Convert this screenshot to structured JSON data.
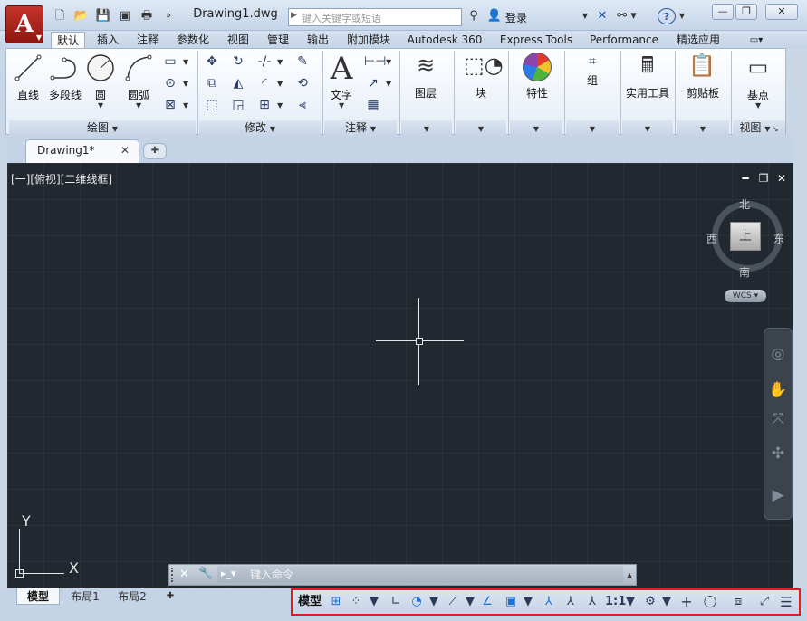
{
  "title": {
    "doc_name": "Drawing1.dwg",
    "search_placeholder": "键入关键字或短语",
    "login_label": "登录",
    "help_label": "?",
    "minimize": "—",
    "restore": "❐",
    "close": "✕"
  },
  "ribbon_tabs": [
    "默认",
    "插入",
    "注释",
    "参数化",
    "视图",
    "管理",
    "输出",
    "附加模块",
    "Autodesk 360",
    "Express Tools",
    "Performance",
    "精选应用"
  ],
  "ribbon": {
    "draw_tools": [
      "直线",
      "多段线",
      "圆",
      "圆弧"
    ],
    "text_label": "文字",
    "layer_label": "图层",
    "block_label": "块",
    "properties_label": "特性",
    "group_label": "组",
    "utilities_label": "实用工具",
    "clipboard_label": "剪贴板",
    "base_label": "基点",
    "panels": [
      "绘图",
      "修改",
      "注释",
      "视图"
    ]
  },
  "doc_tabs": {
    "active_tab": "Drawing1*",
    "close_symbol": "✕",
    "new_symbol": "✚"
  },
  "viewport": {
    "label": "[一][俯视][二维线框]",
    "compass": {
      "north": "北",
      "south": "南",
      "east": "东",
      "west": "西"
    },
    "cube_face": "上",
    "wcs": "WCS",
    "ucs_x": "X",
    "ucs_y": "Y"
  },
  "command": {
    "placeholder": "键入命令"
  },
  "layout_tabs": [
    "模型",
    "布局1",
    "布局2"
  ],
  "status": {
    "model_label": "模型",
    "scale_label": "1:1"
  },
  "colors": {
    "viewport_bg": "#212830",
    "highlight_border": "#e51b1b",
    "ribbon_bg": "#fdfeff"
  }
}
